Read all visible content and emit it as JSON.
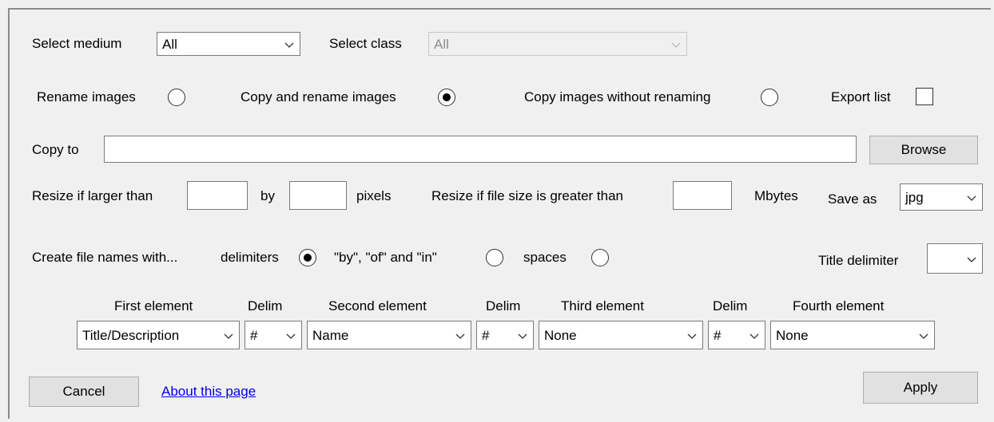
{
  "medium": {
    "label": "Select medium",
    "value": "All"
  },
  "class_select": {
    "label": "Select class",
    "value": "All"
  },
  "mode": {
    "rename_label": "Rename images",
    "copy_rename_label": "Copy and rename images",
    "copy_no_rename_label": "Copy images without renaming",
    "selected": "copy_rename"
  },
  "export": {
    "label": "Export list",
    "checked": false
  },
  "copy_to": {
    "label": "Copy to",
    "value": "",
    "browse_label": "Browse"
  },
  "resize": {
    "label": "Resize if larger than",
    "by_label": "by",
    "pixels_label": "pixels",
    "filesize_label": "Resize if file size is greater than",
    "mbytes_label": "Mbytes",
    "width": "",
    "height": "",
    "filesize": ""
  },
  "save_as": {
    "label": "Save as",
    "value": "jpg"
  },
  "file_names": {
    "label": "Create file names with...",
    "delimiters_label": "delimiters",
    "byofin_label": "\"by\", \"of\" and \"in\"",
    "spaces_label": "spaces",
    "selected": "delimiters",
    "title_delimiter_label": "Title delimiter",
    "title_delimiter_value": ""
  },
  "elements": {
    "headers": [
      "First element",
      "Delim",
      "Second element",
      "Delim",
      "Third element",
      "Delim",
      "Fourth element"
    ],
    "first": "Title/Description",
    "delim1": "#",
    "second": "Name",
    "delim2": "#",
    "third": "None",
    "delim3": "#",
    "fourth": "None"
  },
  "footer": {
    "cancel_label": "Cancel",
    "about_label": "About this page",
    "apply_label": "Apply"
  }
}
